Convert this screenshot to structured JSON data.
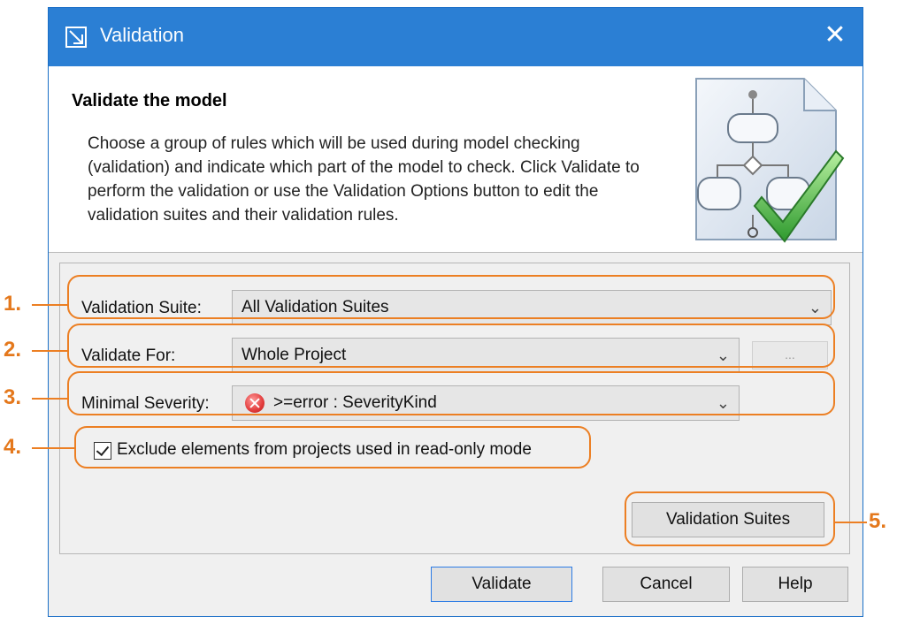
{
  "window": {
    "title": "Validation",
    "close_glyph": "✕"
  },
  "header": {
    "title": "Validate the model",
    "description": "Choose a group of rules which will be used during model checking (validation) and indicate which part of the model to check. Click Validate to perform the validation or use the Validation Options button to edit the validation suites and their validation rules."
  },
  "form": {
    "suite_label": "Validation Suite:",
    "suite_value": "All Validation Suites",
    "validate_for_label": "Validate For:",
    "validate_for_value": "Whole Project",
    "browse_label": "...",
    "severity_label": "Minimal Severity:",
    "severity_value": ">=error : SeverityKind",
    "exclude_label": "Exclude elements from projects used in read-only mode",
    "exclude_checked": true,
    "suites_button": "Validation Suites"
  },
  "footer": {
    "validate": "Validate",
    "cancel": "Cancel",
    "help": "Help"
  },
  "callouts": [
    "1.",
    "2.",
    "3.",
    "4.",
    "5."
  ],
  "colors": {
    "titlebar": "#2b7fd4",
    "callout": "#ec7f23",
    "error": "#e23b3b",
    "check": "#4caf50"
  },
  "icons": [
    "validation-window-icon",
    "close-icon",
    "chevron-down-icon",
    "error-icon",
    "checkbox-checked-icon",
    "activity-diagram-checkmark-icon"
  ]
}
